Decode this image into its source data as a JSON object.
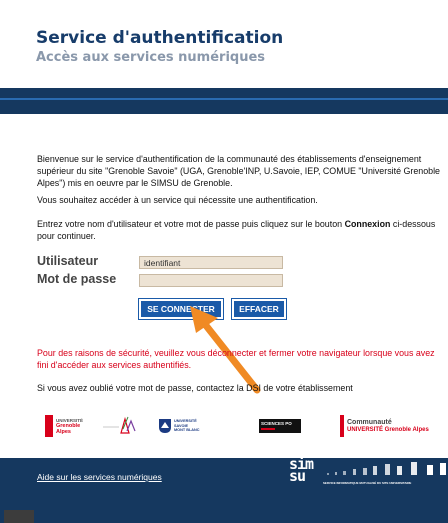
{
  "header": {
    "title": "Service d'authentification",
    "subtitle": "Accès aux services numériques"
  },
  "intro": {
    "text": "Bienvenue sur le service d'authentification de la communauté des établissements d'enseignement supérieur du site \"Grenoble Savoie\" (UGA, Grenoble'INP, U.Savoie, IEP, COMUE \"Université Grenoble Alpes\") mis en oeuvre par le SIMSU de Grenoble.",
    "ask": "Vous souhaitez accéder à un service qui nécessite une authentification.",
    "instruction_before": "Entrez votre nom d'utilisateur et votre mot de passe puis cliquez sur le bouton ",
    "instruction_bold": "Connexion",
    "instruction_after": " ci-dessous pour continuer."
  },
  "form": {
    "username_label": "Utilisateur",
    "username_value": "identifiant",
    "password_label": "Mot de passe",
    "password_value": "",
    "connect_label": "SE CONNECTER",
    "clear_label": "EFFACER"
  },
  "warning": "Pour des raisons de sécurité, veuillez vous déconnecter et fermer votre navigateur lorsque vous avez fini d'accéder aux services authentifiés.",
  "forgot": "Si vous avez oublié votre mot de passe, contactez la DSI de votre établissement",
  "logos": {
    "uga_line1": "UNIVERSITÉ",
    "uga_line2": "Grenoble",
    "uga_line3": "Alpes",
    "usmb_line1": "UNIVERSITÉ",
    "usmb_line2": "SAVOIE",
    "usmb_line3": "MONT BLANC",
    "scpo": "SCIENCES PO",
    "comue_line1": "Communauté",
    "comue_line2": "UNIVERSITÉ Grenoble Alpes"
  },
  "footer": {
    "help_link": "Aide sur les services numériques",
    "simsu_line1": "sim",
    "simsu_line2": "su",
    "simsu_tagline": "SERVICE INFORMATIQUE MUTUALISÉ DU SITE UNIVERSITAIRE"
  },
  "colors": {
    "navy": "#15385f",
    "button": "#1a5aa8",
    "warning": "#d8001a",
    "arrow": "#f08a24"
  }
}
